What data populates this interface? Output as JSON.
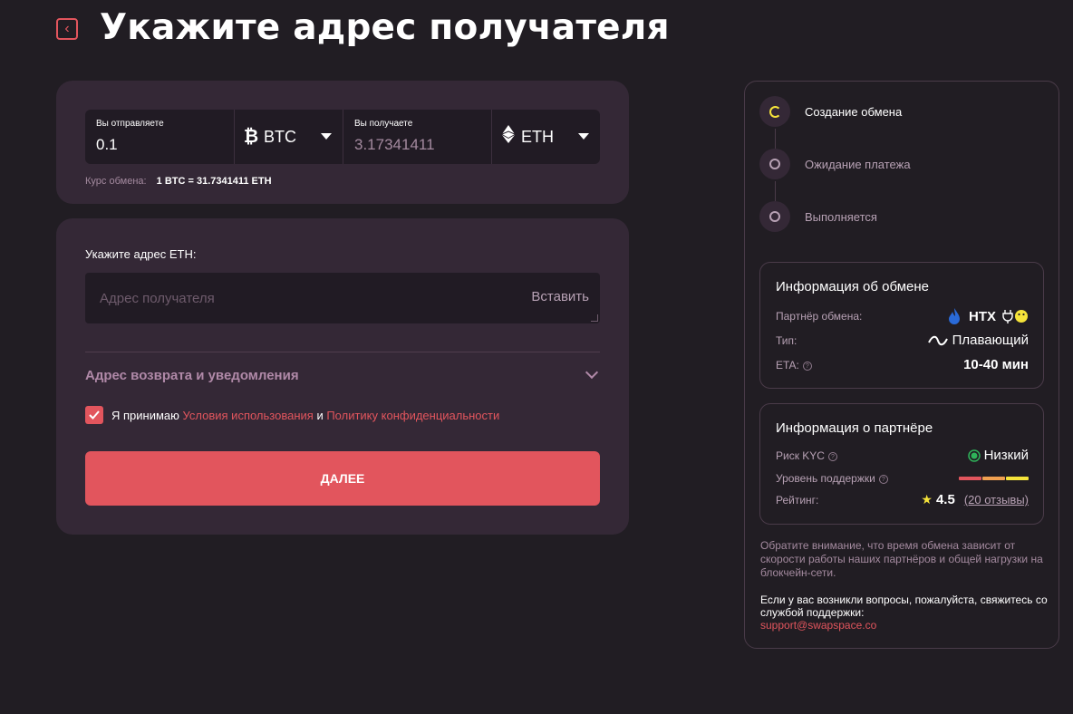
{
  "header": {
    "title": "Укажите адрес получателя",
    "back_icon": "chevron-left-icon"
  },
  "exchange": {
    "send_label": "Вы отправляете",
    "send_amount": "0.1",
    "send_coin": "BTC",
    "receive_label": "Вы получаете",
    "receive_amount": "3.17341411",
    "receive_coin": "ETH",
    "rate_label": "Курс обмена:",
    "rate_value": "1 BTC = 31.7341411 ETH"
  },
  "address": {
    "label": "Укажите адрес ETH:",
    "placeholder": "Адрес получателя",
    "value": "",
    "paste_label": "Вставить",
    "refund_title": "Адрес возврата и уведомления",
    "agree_prefix": "Я принимаю",
    "terms_link": "Условия использования",
    "and_text": "и",
    "privacy_link": "Политику конфиденциальности",
    "agree_checked": true,
    "next_label": "ДАЛЕЕ"
  },
  "steps": [
    {
      "label": "Создание обмена",
      "state": "active"
    },
    {
      "label": "Ожидание платежа",
      "state": "pending"
    },
    {
      "label": "Выполняется",
      "state": "pending"
    }
  ],
  "exchange_info": {
    "title": "Информация об обмене",
    "partner_label": "Партнёр обмена:",
    "partner_value": "HTX",
    "type_label": "Тип:",
    "type_value": "Плавающий",
    "eta_label": "ETA:",
    "eta_value": "10-40 мин"
  },
  "partner_info": {
    "title": "Информация о партнёре",
    "kyc_label": "Риск KYC",
    "kyc_value": "Низкий",
    "support_label": "Уровень поддержки",
    "support_level_fraction": 1.0,
    "rating_label": "Рейтинг:",
    "rating_value": "4.5",
    "reviews_link": "(20 отзывы)"
  },
  "notes": {
    "disclaimer": "Обратите внимание, что время обмена зависит от скорости работы наших партнёров и общей нагрузки на блокчейн-сети.",
    "support_text": "Если у вас возникли вопросы, пожалуйста, свяжитесь со службой поддержки:",
    "support_email": "support@swapspace.co"
  },
  "colors": {
    "background": "#211d23",
    "card": "#342836",
    "accent": "#e2555d",
    "muted": "#a48a9f",
    "spinner": "#f5e33a",
    "kyc_low": "#2fb45a"
  }
}
